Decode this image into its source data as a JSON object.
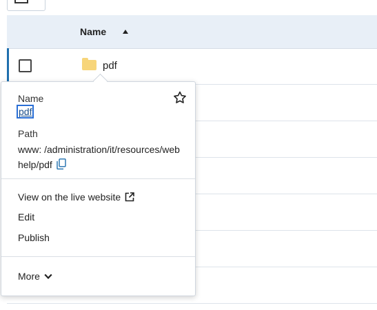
{
  "table": {
    "header_name": "Name",
    "rows": [
      {
        "name": "pdf",
        "selected": true
      }
    ]
  },
  "popover": {
    "name_label": "Name",
    "name_value": "pdf",
    "path_label": "Path",
    "path_value": "www: /administration/it/resources/webhelp/pdf",
    "actions": {
      "view_live": "View on the live website",
      "edit": "Edit",
      "publish": "Publish",
      "more": "More"
    }
  },
  "icons": {
    "star": "star-outline-icon",
    "copy": "copy-icon",
    "external": "external-link-icon",
    "chevron": "chevron-down-icon",
    "folder": "folder-icon"
  },
  "colors": {
    "header_bg": "#e8eff7",
    "accent": "#1f6fae",
    "folder": "#f7d57a"
  }
}
